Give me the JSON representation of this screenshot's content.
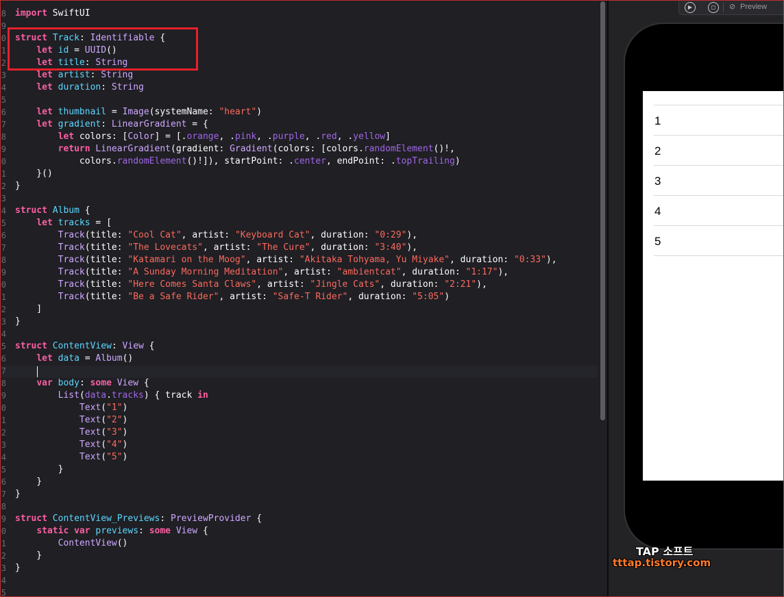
{
  "editor": {
    "gutter": [
      "8",
      "9",
      "0",
      "1",
      "2",
      "3",
      "4",
      "5",
      "6",
      "7",
      "8",
      "9",
      "0",
      "1",
      "2",
      "3",
      "4",
      "5",
      "6",
      "7",
      "8",
      "9",
      "0",
      "1",
      "2",
      "3",
      "4",
      "5",
      "6",
      "7",
      "8",
      "9",
      "0",
      "1",
      "2",
      "3",
      "4",
      "5",
      "6",
      "7",
      "8",
      "9",
      "0",
      "1",
      "2",
      "3",
      "4",
      "5"
    ],
    "lines": [
      [
        [
          "kw",
          "import"
        ],
        [
          "plain",
          " SwiftUI"
        ]
      ],
      [],
      [
        [
          "kw",
          "struct"
        ],
        [
          "plain",
          " "
        ],
        [
          "tyd",
          "Track"
        ],
        [
          "plain",
          ": "
        ],
        [
          "ty",
          "Identifiable"
        ],
        [
          "plain",
          " {"
        ]
      ],
      [
        [
          "plain",
          "    "
        ],
        [
          "kw",
          "let"
        ],
        [
          "plain",
          " "
        ],
        [
          "tyd",
          "id"
        ],
        [
          "plain",
          " = "
        ],
        [
          "ty",
          "UUID"
        ],
        [
          "plain",
          "()"
        ]
      ],
      [
        [
          "plain",
          "    "
        ],
        [
          "kw",
          "let"
        ],
        [
          "plain",
          " "
        ],
        [
          "tyd",
          "title"
        ],
        [
          "plain",
          ": "
        ],
        [
          "ty",
          "String"
        ]
      ],
      [
        [
          "plain",
          "    "
        ],
        [
          "kw",
          "let"
        ],
        [
          "plain",
          " "
        ],
        [
          "tyd",
          "artist"
        ],
        [
          "plain",
          ": "
        ],
        [
          "ty",
          "String"
        ]
      ],
      [
        [
          "plain",
          "    "
        ],
        [
          "kw",
          "let"
        ],
        [
          "plain",
          " "
        ],
        [
          "tyd",
          "duration"
        ],
        [
          "plain",
          ": "
        ],
        [
          "ty",
          "String"
        ]
      ],
      [],
      [
        [
          "plain",
          "    "
        ],
        [
          "kw",
          "let"
        ],
        [
          "plain",
          " "
        ],
        [
          "tyd",
          "thumbnail"
        ],
        [
          "plain",
          " = "
        ],
        [
          "ty",
          "Image"
        ],
        [
          "plain",
          "(systemName: "
        ],
        [
          "str",
          "\"heart\""
        ],
        [
          "plain",
          ")"
        ]
      ],
      [
        [
          "plain",
          "    "
        ],
        [
          "kw",
          "let"
        ],
        [
          "plain",
          " "
        ],
        [
          "tyd",
          "gradient"
        ],
        [
          "plain",
          ": "
        ],
        [
          "ty",
          "LinearGradient"
        ],
        [
          "plain",
          " = {"
        ]
      ],
      [
        [
          "plain",
          "        "
        ],
        [
          "kw",
          "let"
        ],
        [
          "plain",
          " colors: ["
        ],
        [
          "ty",
          "Color"
        ],
        [
          "plain",
          "] = [."
        ],
        [
          "mem",
          "orange"
        ],
        [
          "plain",
          ", ."
        ],
        [
          "mem",
          "pink"
        ],
        [
          "plain",
          ", ."
        ],
        [
          "mem",
          "purple"
        ],
        [
          "plain",
          ", ."
        ],
        [
          "mem",
          "red"
        ],
        [
          "plain",
          ", ."
        ],
        [
          "mem",
          "yellow"
        ],
        [
          "plain",
          "]"
        ]
      ],
      [
        [
          "plain",
          "        "
        ],
        [
          "kw",
          "return"
        ],
        [
          "plain",
          " "
        ],
        [
          "ty",
          "LinearGradient"
        ],
        [
          "plain",
          "(gradient: "
        ],
        [
          "ty",
          "Gradient"
        ],
        [
          "plain",
          "(colors: [colors."
        ],
        [
          "mem",
          "randomElement"
        ],
        [
          "plain",
          "()!,"
        ]
      ],
      [
        [
          "plain",
          "            colors."
        ],
        [
          "mem",
          "randomElement"
        ],
        [
          "plain",
          "()!]), startPoint: ."
        ],
        [
          "mem",
          "center"
        ],
        [
          "plain",
          ", endPoint: ."
        ],
        [
          "mem",
          "topTrailing"
        ],
        [
          "plain",
          ")"
        ]
      ],
      [
        [
          "plain",
          "    }()"
        ]
      ],
      [
        [
          "plain",
          "}"
        ]
      ],
      [],
      [
        [
          "kw",
          "struct"
        ],
        [
          "plain",
          " "
        ],
        [
          "tyd",
          "Album"
        ],
        [
          "plain",
          " {"
        ]
      ],
      [
        [
          "plain",
          "    "
        ],
        [
          "kw",
          "let"
        ],
        [
          "plain",
          " "
        ],
        [
          "tyd",
          "tracks"
        ],
        [
          "plain",
          " = ["
        ]
      ],
      [
        [
          "plain",
          "        "
        ],
        [
          "ty",
          "Track"
        ],
        [
          "plain",
          "(title: "
        ],
        [
          "str",
          "\"Cool Cat\""
        ],
        [
          "plain",
          ", artist: "
        ],
        [
          "str",
          "\"Keyboard Cat\""
        ],
        [
          "plain",
          ", duration: "
        ],
        [
          "str",
          "\"0:29\""
        ],
        [
          "plain",
          "),"
        ]
      ],
      [
        [
          "plain",
          "        "
        ],
        [
          "ty",
          "Track"
        ],
        [
          "plain",
          "(title: "
        ],
        [
          "str",
          "\"The Lovecats\""
        ],
        [
          "plain",
          ", artist: "
        ],
        [
          "str",
          "\"The Cure\""
        ],
        [
          "plain",
          ", duration: "
        ],
        [
          "str",
          "\"3:40\""
        ],
        [
          "plain",
          "),"
        ]
      ],
      [
        [
          "plain",
          "        "
        ],
        [
          "ty",
          "Track"
        ],
        [
          "plain",
          "(title: "
        ],
        [
          "str",
          "\"Katamari on the Moog\""
        ],
        [
          "plain",
          ", artist: "
        ],
        [
          "str",
          "\"Akitaka Tohyama, Yu Miyake\""
        ],
        [
          "plain",
          ", duration: "
        ],
        [
          "str",
          "\"0:33\""
        ],
        [
          "plain",
          "),"
        ]
      ],
      [
        [
          "plain",
          "        "
        ],
        [
          "ty",
          "Track"
        ],
        [
          "plain",
          "(title: "
        ],
        [
          "str",
          "\"A Sunday Morning Meditation\""
        ],
        [
          "plain",
          ", artist: "
        ],
        [
          "str",
          "\"ambientcat\""
        ],
        [
          "plain",
          ", duration: "
        ],
        [
          "str",
          "\"1:17\""
        ],
        [
          "plain",
          "),"
        ]
      ],
      [
        [
          "plain",
          "        "
        ],
        [
          "ty",
          "Track"
        ],
        [
          "plain",
          "(title: "
        ],
        [
          "str",
          "\"Here Comes Santa Claws\""
        ],
        [
          "plain",
          ", artist: "
        ],
        [
          "str",
          "\"Jingle Cats\""
        ],
        [
          "plain",
          ", duration: "
        ],
        [
          "str",
          "\"2:21\""
        ],
        [
          "plain",
          "),"
        ]
      ],
      [
        [
          "plain",
          "        "
        ],
        [
          "ty",
          "Track"
        ],
        [
          "plain",
          "(title: "
        ],
        [
          "str",
          "\"Be a Safe Rider\""
        ],
        [
          "plain",
          ", artist: "
        ],
        [
          "str",
          "\"Safe-T Rider\""
        ],
        [
          "plain",
          ", duration: "
        ],
        [
          "str",
          "\"5:05\""
        ],
        [
          "plain",
          ")"
        ]
      ],
      [
        [
          "plain",
          "    ]"
        ]
      ],
      [
        [
          "plain",
          "}"
        ]
      ],
      [],
      [
        [
          "kw",
          "struct"
        ],
        [
          "plain",
          " "
        ],
        [
          "tyd",
          "ContentView"
        ],
        [
          "plain",
          ": "
        ],
        [
          "ty",
          "View"
        ],
        [
          "plain",
          " {"
        ]
      ],
      [
        [
          "plain",
          "    "
        ],
        [
          "kw",
          "let"
        ],
        [
          "plain",
          " "
        ],
        [
          "tyd",
          "data"
        ],
        [
          "plain",
          " = "
        ],
        [
          "ty",
          "Album"
        ],
        [
          "plain",
          "()"
        ]
      ],
      [],
      [
        [
          "plain",
          "    "
        ],
        [
          "kw",
          "var"
        ],
        [
          "plain",
          " "
        ],
        [
          "tyd",
          "body"
        ],
        [
          "plain",
          ": "
        ],
        [
          "kw",
          "some"
        ],
        [
          "plain",
          " "
        ],
        [
          "ty",
          "View"
        ],
        [
          "plain",
          " {"
        ]
      ],
      [
        [
          "plain",
          "        "
        ],
        [
          "ty",
          "List"
        ],
        [
          "plain",
          "("
        ],
        [
          "mem",
          "data"
        ],
        [
          "plain",
          "."
        ],
        [
          "mem",
          "tracks"
        ],
        [
          "plain",
          ") { track "
        ],
        [
          "kw",
          "in"
        ]
      ],
      [
        [
          "plain",
          "            "
        ],
        [
          "ty",
          "Text"
        ],
        [
          "plain",
          "("
        ],
        [
          "str",
          "\"1\""
        ],
        [
          "plain",
          ")"
        ]
      ],
      [
        [
          "plain",
          "            "
        ],
        [
          "ty",
          "Text"
        ],
        [
          "plain",
          "("
        ],
        [
          "str",
          "\"2\""
        ],
        [
          "plain",
          ")"
        ]
      ],
      [
        [
          "plain",
          "            "
        ],
        [
          "ty",
          "Text"
        ],
        [
          "plain",
          "("
        ],
        [
          "str",
          "\"3\""
        ],
        [
          "plain",
          ")"
        ]
      ],
      [
        [
          "plain",
          "            "
        ],
        [
          "ty",
          "Text"
        ],
        [
          "plain",
          "("
        ],
        [
          "str",
          "\"4\""
        ],
        [
          "plain",
          ")"
        ]
      ],
      [
        [
          "plain",
          "            "
        ],
        [
          "ty",
          "Text"
        ],
        [
          "plain",
          "("
        ],
        [
          "str",
          "\"5\""
        ],
        [
          "plain",
          ")"
        ]
      ],
      [
        [
          "plain",
          "        }"
        ]
      ],
      [
        [
          "plain",
          "    }"
        ]
      ],
      [
        [
          "plain",
          "}"
        ]
      ],
      [],
      [
        [
          "kw",
          "struct"
        ],
        [
          "plain",
          " "
        ],
        [
          "tyd",
          "ContentView_Previews"
        ],
        [
          "plain",
          ": "
        ],
        [
          "ty",
          "PreviewProvider"
        ],
        [
          "plain",
          " {"
        ]
      ],
      [
        [
          "plain",
          "    "
        ],
        [
          "kw",
          "static"
        ],
        [
          "plain",
          " "
        ],
        [
          "kw",
          "var"
        ],
        [
          "plain",
          " "
        ],
        [
          "tyd",
          "previews"
        ],
        [
          "plain",
          ": "
        ],
        [
          "kw",
          "some"
        ],
        [
          "plain",
          " "
        ],
        [
          "ty",
          "View"
        ],
        [
          "plain",
          " {"
        ]
      ],
      [
        [
          "plain",
          "        "
        ],
        [
          "ty",
          "ContentView"
        ],
        [
          "plain",
          "()"
        ]
      ],
      [
        [
          "plain",
          "    }"
        ]
      ],
      [
        [
          "plain",
          "}"
        ]
      ],
      [],
      []
    ]
  },
  "preview": {
    "toolbar": {
      "live_icon": "play-circle-icon",
      "selectable_icon": "selectable-icon",
      "preview_icon": "preview-icon",
      "preview_label": "Preview"
    },
    "list_rows": [
      "1",
      "2",
      "3",
      "4",
      "5"
    ]
  },
  "watermark": {
    "title": "TAP 소프트",
    "url": "tttap.tistory.com"
  },
  "colors": {
    "keyword": "#fc5fa3",
    "type": "#d0a8ff",
    "declaration": "#5dd8ff",
    "string": "#fc6a5d",
    "member": "#a167e6",
    "highlight_box": "#e8202a",
    "editor_background": "#1f1f24"
  }
}
